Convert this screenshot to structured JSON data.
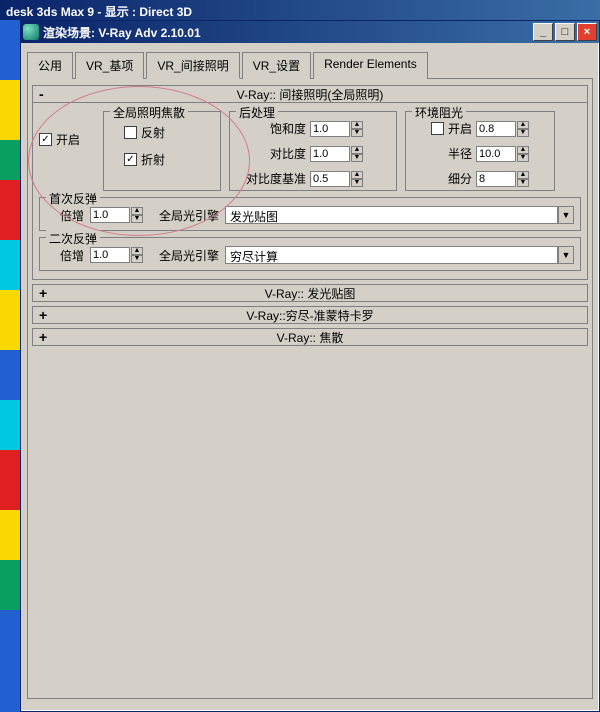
{
  "very_top": "desk 3ds Max 9      - 显示 : Direct 3D",
  "window": {
    "title": "渲染场景: V-Ray Adv 2.10.01"
  },
  "tabs": {
    "items": [
      {
        "label": "公用"
      },
      {
        "label": "VR_基项"
      },
      {
        "label": "VR_间接照明"
      },
      {
        "label": "VR_设置"
      },
      {
        "label": "Render Elements"
      }
    ],
    "active_index": 2
  },
  "rollup_gi": {
    "sign": "-",
    "title": "V-Ray:: 间接照明(全局照明)",
    "enable": {
      "label": "开启",
      "checked": true
    },
    "caustics": {
      "legend": "全局照明焦散",
      "reflect": {
        "label": "反射",
        "checked": false
      },
      "refract": {
        "label": "折射",
        "checked": true
      }
    },
    "postproc": {
      "legend": "后处理",
      "saturation": {
        "label": "饱和度",
        "value": "1.0"
      },
      "contrast": {
        "label": "对比度",
        "value": "1.0"
      },
      "contrast_base": {
        "label": "对比度基准",
        "value": "0.5"
      }
    },
    "ao": {
      "legend": "环境阻光",
      "enable": {
        "label": "开启",
        "checked": false,
        "value": "0.8"
      },
      "radius": {
        "label": "半径",
        "value": "10.0"
      },
      "subdivs": {
        "label": "细分",
        "value": "8"
      }
    },
    "primary": {
      "legend": "首次反弹",
      "mult": {
        "label": "倍增",
        "value": "1.0"
      },
      "engine_label": "全局光引擎",
      "engine_value": "发光贴图"
    },
    "secondary": {
      "legend": "二次反弹",
      "mult": {
        "label": "倍增",
        "value": "1.0"
      },
      "engine_label": "全局光引擎",
      "engine_value": "穷尽计算"
    }
  },
  "rollup_collapsed": [
    {
      "sign": "+",
      "title": "V-Ray:: 发光贴图"
    },
    {
      "sign": "+",
      "title": "V-Ray::穷尽-准蒙特卡罗"
    },
    {
      "sign": "+",
      "title": "V-Ray:: 焦散"
    }
  ]
}
